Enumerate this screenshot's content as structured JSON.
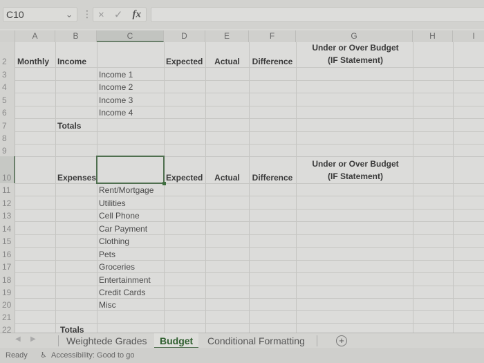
{
  "formula_bar": {
    "name_box": "C10",
    "cancel_icon": "×",
    "enter_icon": "✓",
    "fx_label": "fx",
    "formula_value": ""
  },
  "columns": [
    "A",
    "B",
    "C",
    "D",
    "E",
    "F",
    "G",
    "H",
    "I"
  ],
  "active_column": "C",
  "rows": [
    "2",
    "3",
    "4",
    "5",
    "6",
    "7",
    "8",
    "9",
    "10",
    "11",
    "12",
    "13",
    "14",
    "15",
    "16",
    "17",
    "18",
    "19",
    "20",
    "21",
    "22"
  ],
  "active_row": "10",
  "income_section": {
    "title_a": "Monthly",
    "title_b": "Income",
    "headers": {
      "expected": "Expected",
      "actual": "Actual",
      "difference": "Difference",
      "under_over_line1": "Under or Over Budget",
      "under_over_line2": "(IF Statement)"
    },
    "items": [
      "Income 1",
      "Income 2",
      "Income 3",
      "Income 4"
    ],
    "totals": "Totals"
  },
  "expenses_section": {
    "title": "Expenses",
    "headers": {
      "expected": "Expected",
      "actual": "Actual",
      "difference": "Difference",
      "under_over_line1": "Under or Over Budget",
      "under_over_line2": "(IF Statement)"
    },
    "items": [
      "Rent/Mortgage",
      "Utilities",
      "Cell Phone",
      "Car Payment",
      "Clothing",
      "Pets",
      "Groceries",
      "Entertainment",
      "Credit Cards",
      "Misc"
    ],
    "totals": "Totals"
  },
  "sheet_tabs": [
    {
      "label": "Weightede Grades",
      "active": false
    },
    {
      "label": "Budget",
      "active": true
    },
    {
      "label": "Conditional Formatting",
      "active": false
    }
  ],
  "add_sheet_icon": "+",
  "status_bar": {
    "ready": "Ready",
    "accessibility": "Accessibility: Good to go"
  }
}
